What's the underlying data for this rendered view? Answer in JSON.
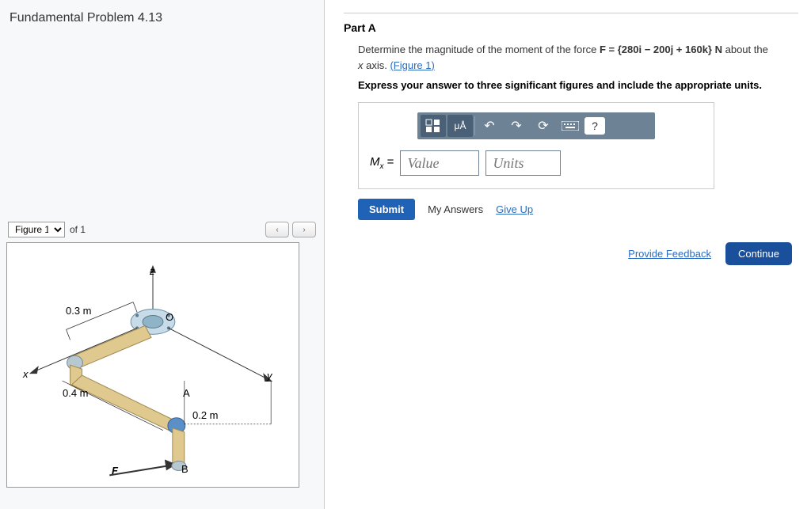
{
  "problem_title": "Fundamental Problem 4.13",
  "figure": {
    "selector_value": "Figure 1",
    "of_text": "of 1",
    "prev": "‹",
    "next": "›",
    "labels": {
      "z": "z",
      "o": "O",
      "x": "x",
      "y": "y",
      "a": "A",
      "b": "B",
      "f": "F",
      "d03": "0.3 m",
      "d04": "0.4 m",
      "d02": "0.2 m"
    }
  },
  "part": {
    "title": "Part A",
    "prompt_pre": "Determine the magnitude of the moment of the force ",
    "force_vec": "F",
    "force_expr": " = {280i − 200j + 160k} N",
    "prompt_post": " about the ",
    "axis": "x axis.",
    "figure_link": "(Figure 1)",
    "instruction": "Express your answer to three significant figures and include the appropriate units.",
    "toolbar": {
      "templates": "⬚⬚",
      "greek": "μÅ",
      "undo": "↶",
      "redo": "↷",
      "reset": "⟳",
      "keyboard": "⌨",
      "help": "?"
    },
    "answer_label_var": "M",
    "answer_label_sub": "x",
    "answer_label_eq": " =",
    "value_placeholder": "Value",
    "units_placeholder": "Units",
    "submit": "Submit",
    "my_answers": "My Answers",
    "give_up": "Give Up"
  },
  "footer": {
    "feedback": "Provide Feedback",
    "continue": "Continue"
  }
}
